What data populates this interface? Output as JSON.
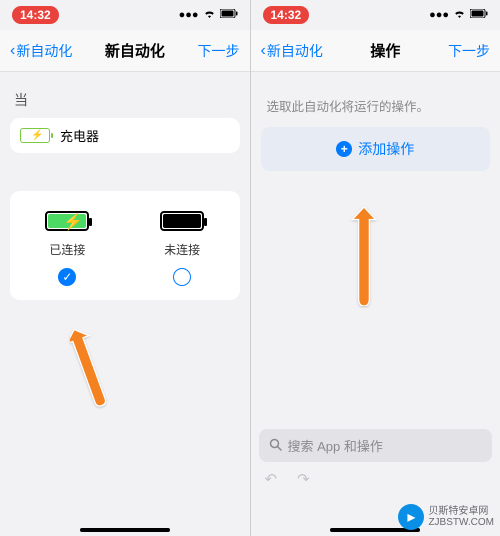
{
  "status": {
    "time": "14:32",
    "signal": "•••",
    "wifi": "wifi",
    "battery": "batt"
  },
  "left": {
    "nav": {
      "back": "新自动化",
      "title": "新自动化",
      "next": "下一步"
    },
    "when_label": "当",
    "trigger_label": "充电器",
    "connected_label": "已连接",
    "disconnected_label": "未连接"
  },
  "right": {
    "nav": {
      "back": "新自动化",
      "title": "操作",
      "next": "下一步"
    },
    "hint": "选取此自动化将运行的操作。",
    "add_action_label": "添加操作",
    "search_placeholder": "搜索 App 和操作"
  },
  "watermark": {
    "brand": "贝斯特安卓网",
    "url": "ZJBSTW.COM"
  }
}
